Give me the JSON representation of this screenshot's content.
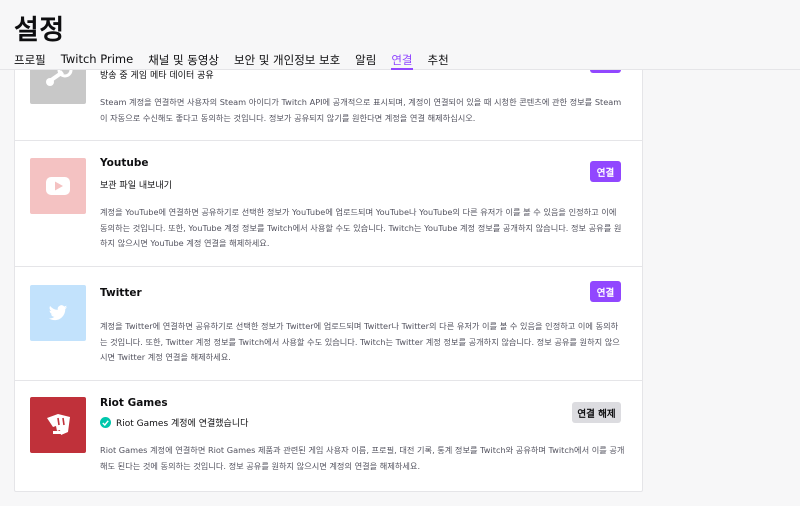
{
  "header": {
    "title": "설정",
    "tabs": [
      {
        "label": "프로필",
        "active": false
      },
      {
        "label": "Twitch Prime",
        "active": false
      },
      {
        "label": "채널 및 동영상",
        "active": false
      },
      {
        "label": "보안 및 개인정보 보호",
        "active": false
      },
      {
        "label": "알림",
        "active": false
      },
      {
        "label": "연결",
        "active": true
      },
      {
        "label": "추천",
        "active": false
      }
    ]
  },
  "colors": {
    "accent": "#9147ff",
    "success": "#00c7ac",
    "youtube_logo_bg": "#f4c2c2",
    "twitter_logo_bg": "#c2e2fc",
    "riot_logo_bg": "#c0313a"
  },
  "connections": {
    "steam": {
      "sub": "방송 중 게임 메타 데이터 공유",
      "desc": "Steam 계정을 연결하면 사용자의 Steam 아이디가 Twitch API에 공개적으로 표시되며, 계정이 연결되어 있을 때 시청한 콘텐츠에 관한 정보를 Steam이 자동으로 수신해도 좋다고 동의하는 것입니다. 정보가 공유되지 않기를 원한다면 계정을 연결 해제하십시오.",
      "icon": "steam-icon"
    },
    "youtube": {
      "name": "Youtube",
      "sub": "보관 파일 내보내기",
      "button": "연결",
      "desc": "계정을 YouTube에 연결하면 공유하기로 선택한 정보가 YouTube에 업로드되며 YouTube나 YouTube의 다른 유저가 이를 볼 수 있음을 인정하고 이에 동의하는 것입니다. 또한, YouTube 계정 정보를 Twitch에서 사용할 수도 있습니다. Twitch는 YouTube 계정 정보를 공개하지 않습니다. 정보 공유를 원하지 않으시면 YouTube 계정 연결을 해제하세요.",
      "icon": "youtube-icon"
    },
    "twitter": {
      "name": "Twitter",
      "button": "연결",
      "desc": "계정을 Twitter에 연결하면 공유하기로 선택한 정보가 Twitter에 업로드되며 Twitter나 Twitter의 다른 유저가 이를 볼 수 있음을 인정하고 이에 동의하는 것입니다. 또한, Twitter 계정 정보를 Twitch에서 사용할 수도 있습니다. Twitch는 Twitter 계정 정보를 공개하지 않습니다. 정보 공유를 원하지 않으시면 Twitter 계정 연결을 해제하세요.",
      "icon": "twitter-icon"
    },
    "riot": {
      "name": "Riot Games",
      "status": "Riot Games 계정에 연결했습니다",
      "button": "연결 해제",
      "desc": "Riot Games 계정에 연결하면 Riot Games 제품과 관련된 게임 사용자 이름, 프로필, 대전 기록, 통계 정보를 Twitch와 공유하며 Twitch에서 이를 공개해도 된다는 것에 동의하는 것입니다. 정보 공유를 원하지 않으시면 계정의 연결을 해제하세요.",
      "icon": "riot-fist-icon"
    }
  }
}
